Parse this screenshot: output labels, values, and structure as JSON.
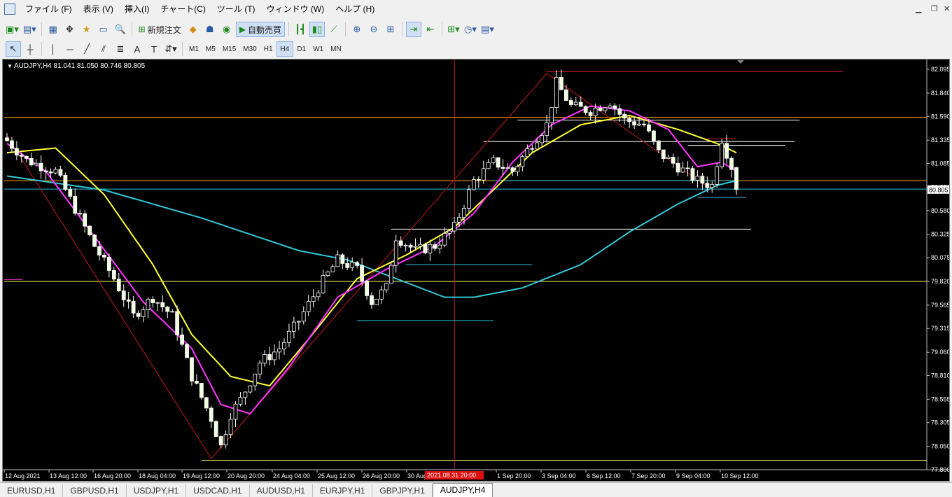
{
  "menu": [
    "ファイル (F)",
    "表示 (V)",
    "挿入(I)",
    "チャート(C)",
    "ツール (T)",
    "ウィンドウ (W)",
    "ヘルプ (H)"
  ],
  "toolbar": {
    "new_order_label": "新規注文",
    "auto_trade_label": "自動売買",
    "timeframes": [
      "M1",
      "M5",
      "M15",
      "M30",
      "H1",
      "H4",
      "D1",
      "W1",
      "MN"
    ],
    "active_timeframe": "H4",
    "notification_count": "1"
  },
  "chart": {
    "header": "AUDJPY,H4  81.041 81.050 80.746 80.805",
    "current_price_label": "80.805",
    "crosshair_date_label": "2021.08.31 20:00"
  },
  "chart_data": {
    "type": "candlestick",
    "symbol": "AUDJPY",
    "timeframe": "H4",
    "ohlc_last": {
      "open": 81.041,
      "high": 81.05,
      "low": 80.746,
      "close": 80.805
    },
    "y_ticks": [
      "82.095",
      "81.840",
      "81.590",
      "81.335",
      "81.085",
      "80.830",
      "80.580",
      "80.325",
      "80.075",
      "79.820",
      "79.565",
      "79.315",
      "79.060",
      "78.810",
      "78.555",
      "78.305",
      "78.050",
      "77.800"
    ],
    "ylim": [
      77.8,
      82.2
    ],
    "x_ticks": [
      "12 Aug 2021",
      "13 Aug 12:00",
      "16 Aug 20:00",
      "18 Aug 04:00",
      "19 Aug 12:00",
      "20 Aug 20:00",
      "24 Aug 04:00",
      "25 Aug 12:00",
      "26 Aug 20:00",
      "30 Aug 04:00",
      "1 Sep 20:00",
      "3 Sep 04:00",
      "6 Sep 12:00",
      "7 Sep 20:00",
      "9 Sep 04:00",
      "10 Sep 12:00"
    ],
    "candle_count": 151,
    "close_anchors": [
      [
        0,
        81.33
      ],
      [
        4,
        81.12
      ],
      [
        10,
        81.0
      ],
      [
        14,
        80.6
      ],
      [
        18,
        80.2
      ],
      [
        22,
        79.85
      ],
      [
        26,
        79.45
      ],
      [
        30,
        79.65
      ],
      [
        34,
        79.45
      ],
      [
        38,
        78.8
      ],
      [
        42,
        78.35
      ],
      [
        44,
        78.05
      ],
      [
        46,
        78.4
      ],
      [
        48,
        78.55
      ],
      [
        52,
        78.95
      ],
      [
        56,
        79.1
      ],
      [
        60,
        79.4
      ],
      [
        64,
        79.75
      ],
      [
        68,
        80.05
      ],
      [
        72,
        79.95
      ],
      [
        75,
        79.6
      ],
      [
        78,
        79.75
      ],
      [
        80,
        80.3
      ],
      [
        84,
        80.15
      ],
      [
        88,
        80.2
      ],
      [
        92,
        80.4
      ],
      [
        96,
        80.9
      ],
      [
        100,
        81.1
      ],
      [
        104,
        81.0
      ],
      [
        108,
        81.3
      ],
      [
        111,
        81.5
      ],
      [
        113,
        81.95
      ],
      [
        116,
        81.7
      ],
      [
        120,
        81.65
      ],
      [
        124,
        81.75
      ],
      [
        127,
        81.55
      ],
      [
        131,
        81.5
      ],
      [
        134,
        81.2
      ],
      [
        138,
        81.05
      ],
      [
        142,
        80.9
      ],
      [
        145,
        80.85
      ],
      [
        147,
        81.35
      ],
      [
        149,
        81.05
      ],
      [
        150,
        80.805
      ]
    ],
    "ma_yellow": [
      [
        0,
        81.2
      ],
      [
        10,
        81.25
      ],
      [
        20,
        80.75
      ],
      [
        30,
        80.0
      ],
      [
        38,
        79.25
      ],
      [
        46,
        78.8
      ],
      [
        54,
        78.7
      ],
      [
        62,
        79.2
      ],
      [
        72,
        79.85
      ],
      [
        82,
        80.1
      ],
      [
        92,
        80.4
      ],
      [
        100,
        80.8
      ],
      [
        108,
        81.2
      ],
      [
        118,
        81.5
      ],
      [
        128,
        81.6
      ],
      [
        138,
        81.45
      ],
      [
        146,
        81.3
      ],
      [
        150,
        81.2
      ]
    ],
    "ma_magenta": [
      [
        0,
        81.3
      ],
      [
        8,
        81.0
      ],
      [
        18,
        80.3
      ],
      [
        28,
        79.6
      ],
      [
        38,
        79.1
      ],
      [
        44,
        78.5
      ],
      [
        50,
        78.4
      ],
      [
        58,
        78.9
      ],
      [
        68,
        79.65
      ],
      [
        78,
        79.95
      ],
      [
        88,
        80.2
      ],
      [
        96,
        80.55
      ],
      [
        104,
        81.1
      ],
      [
        112,
        81.5
      ],
      [
        120,
        81.7
      ],
      [
        128,
        81.65
      ],
      [
        136,
        81.45
      ],
      [
        142,
        81.05
      ],
      [
        147,
        81.1
      ],
      [
        150,
        81.0
      ]
    ],
    "ma_cyan": [
      [
        0,
        80.95
      ],
      [
        20,
        80.8
      ],
      [
        40,
        80.5
      ],
      [
        60,
        80.15
      ],
      [
        70,
        80.05
      ],
      [
        80,
        79.85
      ],
      [
        90,
        79.65
      ],
      [
        96,
        79.65
      ],
      [
        106,
        79.75
      ],
      [
        118,
        80.0
      ],
      [
        128,
        80.35
      ],
      [
        138,
        80.65
      ],
      [
        146,
        80.85
      ],
      [
        150,
        80.9
      ]
    ],
    "hlines": [
      {
        "price": 81.58,
        "color": "#ffa500",
        "full": true
      },
      {
        "price": 80.9,
        "color": "#ffa500",
        "full": true
      },
      {
        "price": 79.82,
        "color": "#ffff66",
        "full": true
      },
      {
        "price": 77.9,
        "color": "#ffff66",
        "from": 40,
        "full": false
      },
      {
        "price": 80.81,
        "color": "#20c0e0",
        "full": true
      }
    ],
    "segments": [
      {
        "p": 82.07,
        "from": 111,
        "to": 172,
        "color": "#d02020"
      },
      {
        "p": 81.55,
        "from": 105,
        "to": 163,
        "color": "#ffffff"
      },
      {
        "p": 81.32,
        "from": 98,
        "to": 162,
        "color": "#ffffff"
      },
      {
        "p": 81.28,
        "from": 140,
        "to": 160,
        "color": "#ffffff"
      },
      {
        "p": 81.35,
        "from": 144,
        "to": 150,
        "color": "#d02020"
      },
      {
        "p": 80.9,
        "from": 100,
        "to": 150,
        "color": "#20c0e0"
      },
      {
        "p": 80.38,
        "from": 79,
        "to": 153,
        "color": "#ffffff"
      },
      {
        "p": 80.0,
        "from": 82,
        "to": 108,
        "color": "#20c0e0"
      },
      {
        "p": 79.4,
        "from": 72,
        "to": 100,
        "color": "#20c0e0"
      },
      {
        "p": 80.72,
        "from": 142,
        "to": 152,
        "color": "#20c0e0"
      }
    ],
    "trendlines": [
      [
        [
          0,
          81.38
        ],
        [
          42,
          77.92
        ]
      ],
      [
        [
          42,
          77.92
        ],
        [
          111,
          82.05
        ]
      ],
      [
        [
          111,
          82.05
        ],
        [
          145,
          80.8
        ]
      ]
    ],
    "crosshair_index": 92
  },
  "tabs": [
    "EURUSD,H1",
    "GBPUSD,H1",
    "USDJPY,H1",
    "USDCAD,H1",
    "AUDUSD,H1",
    "EURJPY,H1",
    "GBPJPY,H1",
    "AUDJPY,H4"
  ],
  "active_tab": "AUDJPY,H4"
}
